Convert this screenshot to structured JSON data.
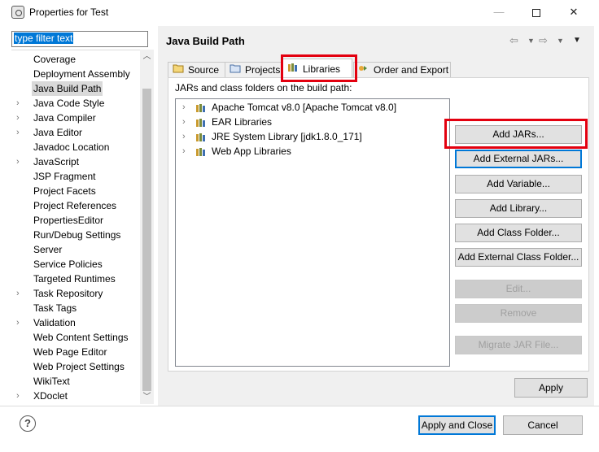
{
  "window": {
    "title": "Properties for Test",
    "minimize": "—",
    "close": "✕"
  },
  "filter": {
    "value": "type filter text"
  },
  "tree": [
    {
      "label": "Coverage",
      "expandable": false
    },
    {
      "label": "Deployment Assembly",
      "expandable": false
    },
    {
      "label": "Java Build Path",
      "expandable": false,
      "selected": true
    },
    {
      "label": "Java Code Style",
      "expandable": true
    },
    {
      "label": "Java Compiler",
      "expandable": true
    },
    {
      "label": "Java Editor",
      "expandable": true
    },
    {
      "label": "Javadoc Location",
      "expandable": false
    },
    {
      "label": "JavaScript",
      "expandable": true
    },
    {
      "label": "JSP Fragment",
      "expandable": false
    },
    {
      "label": "Project Facets",
      "expandable": false
    },
    {
      "label": "Project References",
      "expandable": false
    },
    {
      "label": "PropertiesEditor",
      "expandable": false
    },
    {
      "label": "Run/Debug Settings",
      "expandable": false
    },
    {
      "label": "Server",
      "expandable": false
    },
    {
      "label": "Service Policies",
      "expandable": false
    },
    {
      "label": "Targeted Runtimes",
      "expandable": false
    },
    {
      "label": "Task Repository",
      "expandable": true
    },
    {
      "label": "Task Tags",
      "expandable": false
    },
    {
      "label": "Validation",
      "expandable": true
    },
    {
      "label": "Web Content Settings",
      "expandable": false
    },
    {
      "label": "Web Page Editor",
      "expandable": false
    },
    {
      "label": "Web Project Settings",
      "expandable": false
    },
    {
      "label": "WikiText",
      "expandable": false
    },
    {
      "label": "XDoclet",
      "expandable": true
    }
  ],
  "page": {
    "title": "Java Build Path",
    "tabs": [
      {
        "label": "Source",
        "icon": "source-folder-icon"
      },
      {
        "label": "Projects",
        "icon": "project-icon"
      },
      {
        "label": "Libraries",
        "icon": "library-icon",
        "active": true
      },
      {
        "label": "Order and Export",
        "icon": "order-export-icon"
      }
    ],
    "subtitle": "JARs and class folders on the build path:",
    "entries": [
      {
        "label": "Apache Tomcat v8.0 [Apache Tomcat v8.0]"
      },
      {
        "label": "EAR Libraries"
      },
      {
        "label": "JRE System Library [jdk1.8.0_171]"
      },
      {
        "label": "Web App Libraries"
      }
    ],
    "buttons": [
      {
        "label": "Add JARs...",
        "enabled": true
      },
      {
        "label": "Add External JARs...",
        "enabled": true,
        "focused": true
      },
      {
        "label": "Add Variable...",
        "enabled": true
      },
      {
        "label": "Add Library...",
        "enabled": true
      },
      {
        "label": "Add Class Folder...",
        "enabled": true
      },
      {
        "label": "Add External Class Folder...",
        "enabled": true
      },
      {
        "label": "Edit...",
        "enabled": false
      },
      {
        "label": "Remove",
        "enabled": false
      },
      {
        "label": "Migrate JAR File...",
        "enabled": false
      }
    ],
    "apply": "Apply"
  },
  "footer": {
    "help": "?",
    "apply_close": "Apply and Close",
    "cancel": "Cancel"
  },
  "colors": {
    "highlight": "#e3000f",
    "selection": "#0078d7"
  }
}
